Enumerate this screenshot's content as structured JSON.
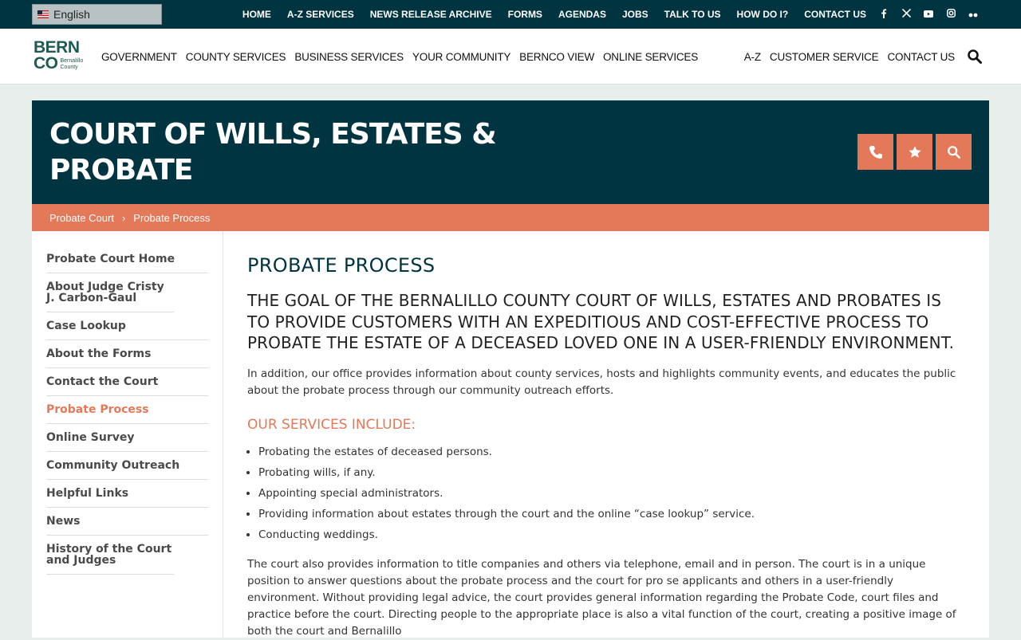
{
  "language": {
    "selected": "English"
  },
  "top_links": [
    "HOME",
    "A-Z SERVICES",
    "NEWS RELEASE ARCHIVE",
    "FORMS",
    "AGENDAS",
    "JOBS",
    "TALK TO US",
    "HOW DO I?",
    "CONTACT US"
  ],
  "social_icons": [
    "facebook-icon",
    "x-icon",
    "youtube-icon",
    "instagram-icon",
    "flickr-icon"
  ],
  "logo": {
    "line1": "BERN",
    "line2": "CO",
    "sub1": "Bernalillo",
    "sub2": "County"
  },
  "main_nav": [
    "GOVERNMENT",
    "COUNTY SERVICES",
    "BUSINESS SERVICES",
    "YOUR COMMUNITY",
    "BERNCO VIEW",
    "ONLINE SERVICES"
  ],
  "right_nav": [
    "A-Z",
    "CUSTOMER SERVICE",
    "CONTACT US"
  ],
  "banner": {
    "title": "COURT OF WILLS, ESTATES & PROBATE"
  },
  "breadcrumb": [
    "Probate Court",
    "Probate Process"
  ],
  "sidebar": {
    "items": [
      "Probate Court Home",
      "About Judge Cristy J. Carbon-Gaul",
      "Case Lookup",
      "About the Forms",
      "Contact the Court",
      "Probate Process",
      "Online Survey",
      "Community Outreach",
      "Helpful Links",
      "News",
      "History of the Court and Judges"
    ],
    "active": "Probate Process"
  },
  "main": {
    "heading": "PROBATE PROCESS",
    "subheading": "THE GOAL OF THE BERNALILLO COUNTY COURT OF WILLS, ESTATES AND PROBATES IS TO PROVIDE CUSTOMERS WITH AN EXPEDITIOUS AND COST-EFFECTIVE PROCESS TO PROBATE THE ESTATE OF A DECEASED LOVED ONE IN A USER-FRIENDLY ENVIRONMENT.",
    "intro": "In addition, our office provides information about county services, hosts and highlights community events, and educates the public about the probate process through our community outreach efforts.",
    "services_heading": "OUR SERVICES INCLUDE:",
    "services": [
      "Probating the estates of deceased persons.",
      "Probating wills, if any.",
      "Appointing special administrators.",
      "Providing information about estates through the court and the online “case lookup” service.",
      "Conducting weddings."
    ],
    "body": "The court also provides information to title companies and others via telephone, email and in person. The court is in a unique position to answer questions about the probate process and the court for pro se applicants and others in a user-friendly environment. Without providing legal advice, the court provides general information regarding the Probate Code, court files and practice before the court. Directing people to the appropriate place is also a vital function of the court, creating a positive image of both the court and Bernalillo"
  },
  "colors": {
    "dark_teal": "#003440",
    "accent": "#e37959",
    "logo_green": "#1f5b53"
  }
}
